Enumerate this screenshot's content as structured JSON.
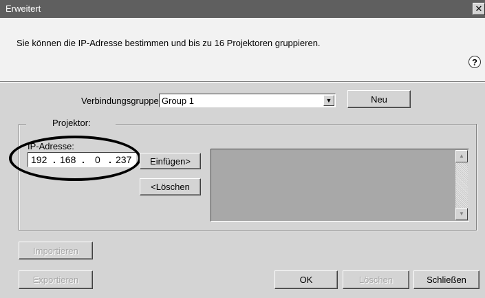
{
  "window": {
    "title": "Erweitert",
    "close_glyph": "✕"
  },
  "header": {
    "description": "Sie können die IP-Adresse bestimmen und bis zu 16 Projektoren gruppieren.",
    "help_glyph": "?"
  },
  "connection": {
    "label": "Verbindungsgruppe:",
    "value": "Group 1",
    "new_label": "Neu",
    "arrow_glyph": "▼"
  },
  "projector": {
    "group_title": "Projektor:",
    "ip_label": "IP-Adresse:",
    "ip": {
      "o1": "192",
      "o2": "168",
      "o3": "0",
      "o4": "237",
      "sep": "."
    },
    "insert_label": "Einfügen>",
    "delete_label": "<Löschen",
    "list_items": []
  },
  "scroll": {
    "up_glyph": "▲",
    "down_glyph": "▼"
  },
  "footer": {
    "import_label": "Importieren",
    "export_label": "Exportieren",
    "ok_label": "OK",
    "delete_label": "Löschen",
    "close_label": "Schließen"
  },
  "colors": {
    "titlebar": "#5f5f5f",
    "dialog": "#d4d4d4",
    "header": "#f2f2f2",
    "list": "#a8a8a8",
    "highlight": "#000000"
  }
}
